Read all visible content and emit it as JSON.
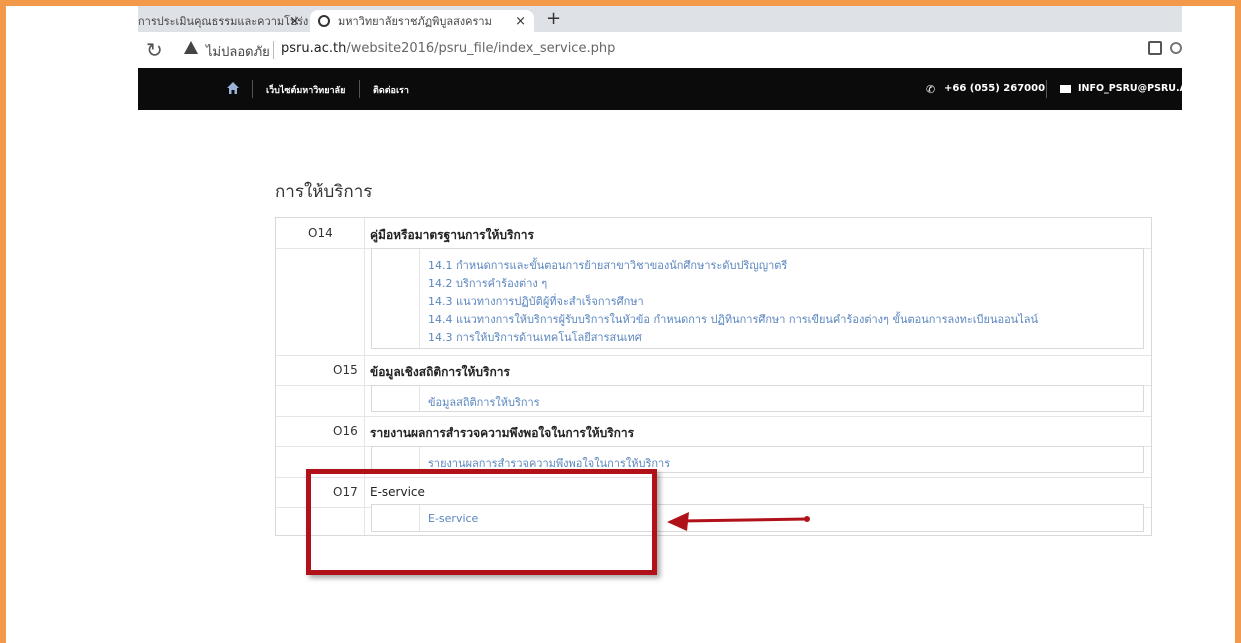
{
  "browser": {
    "tabs": [
      {
        "title": "การประเมินคุณธรรมและความโปร่ง"
      },
      {
        "title": "มหาวิทยาลัยราชภัฏพิบูลสงคราม"
      }
    ],
    "security_label": "ไม่ปลอดภัย",
    "url_domain": "psru.ac.th",
    "url_path": "/website2016/psru_file/index_service.php"
  },
  "site_nav": {
    "home_icon": "home-icon",
    "link_university": "เว็บไซต์มหาวิทยาลัย",
    "link_contact": "ติดต่อเรา",
    "phone": "+66 (055) 267000",
    "email": "INFO_PSRU@PSRU.AC"
  },
  "page": {
    "title": "การให้บริการ",
    "sections": [
      {
        "code": "O14",
        "title": "คู่มือหรือมาตรฐานการให้บริการ",
        "links": [
          "14.1 กำหนดการและขั้นตอนการย้ายสาขาวิชาของนักศึกษาระดับปริญญาตรี",
          "14.2 บริการคำร้องต่าง ๆ",
          "14.3 แนวทางการปฏิบัติผู้ที่จะสำเร็จการศึกษา",
          "14.4 แนวทางการให้บริการผู้รับบริการในหัวข้อ กำหนดการ ปฏิทินการศึกษา การเขียนคำร้องต่างๆ ขั้นตอนการลงทะเบียนออนไลน์",
          "14.3 การให้บริการด้านเทคโนโลยีสารสนเทศ"
        ]
      },
      {
        "code": "O15",
        "title": "ข้อมูลเชิงสถิติการให้บริการ",
        "links": [
          "ข้อมูลสถิติการให้บริการ"
        ]
      },
      {
        "code": "O16",
        "title": "รายงานผลการสำรวจความพึงพอใจในการให้บริการ",
        "links": [
          "รายงานผลการสำรวจความพึงพอใจในการให้บริการ"
        ]
      },
      {
        "code": "O17",
        "title": "E-service",
        "links": [
          "E-service"
        ]
      }
    ]
  },
  "annotation": {
    "highlight_color": "#b11219",
    "frame_color": "#f39a4a"
  }
}
